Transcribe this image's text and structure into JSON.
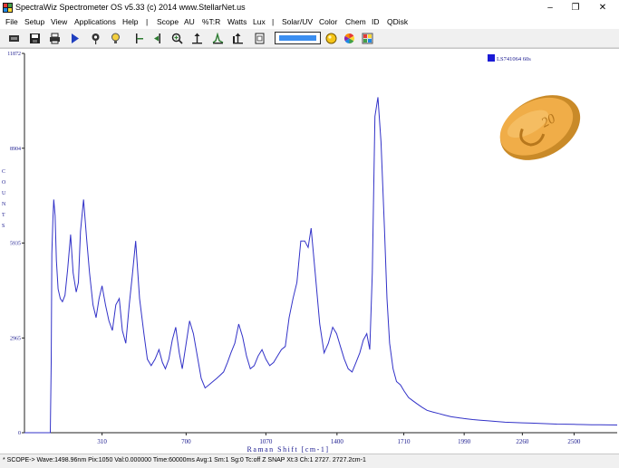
{
  "window": {
    "title": "SpectraWiz  Spectrometer OS v5.33 (c) 2014    www.StellarNet.us",
    "controls": [
      "–",
      "❐",
      "✕"
    ]
  },
  "menu": {
    "items": [
      "File",
      "Setup",
      "View",
      "Applications",
      "Help",
      "|",
      "Scope",
      "AU",
      "%T:R",
      "Watts",
      "Lux",
      "|",
      "Solar/UV",
      "Color",
      "Chem",
      "ID",
      "QDisk"
    ]
  },
  "toolbar": {
    "icons": [
      "toolbar-icon",
      "save-icon",
      "print-icon",
      "play-icon",
      "pin-icon",
      "lightbulb-icon",
      "cursor-left-icon",
      "cursor-right-icon",
      "zoom-icon",
      "autoscale-icon",
      "peak-icon",
      "baseline-icon",
      "page-icon",
      "blue-bar-box",
      "sphere-icon",
      "color-wheel-icon",
      "palette-icon"
    ]
  },
  "chart_data": {
    "type": "line",
    "title": "",
    "xlabel": "Raman Shift [cm-1]",
    "ylabel": "",
    "side_label": "C O U N T S",
    "xlim": [
      -50,
      2700
    ],
    "ylim": [
      0,
      11872
    ],
    "x_ticks": [
      310,
      700,
      1070,
      1400,
      1710,
      1990,
      2260,
      2500
    ],
    "y_ticks": [
      "11872",
      "8904",
      "5935",
      "2965",
      "0"
    ],
    "y_tick_values": [
      11872,
      8904,
      5935,
      2965,
      0
    ],
    "legend": {
      "label": "LS741064 60s",
      "color": "#1b1bd6",
      "position": "top-right"
    },
    "series": [
      {
        "color": "#3232c8",
        "x": [
          -50,
          70,
          74,
          77,
          82,
          86,
          92,
          98,
          106,
          116,
          126,
          138,
          150,
          164,
          176,
          190,
          200,
          210,
          224,
          238,
          252,
          268,
          282,
          296,
          310,
          326,
          342,
          358,
          374,
          390,
          404,
          420,
          436,
          450,
          466,
          484,
          504,
          520,
          538,
          556,
          574,
          590,
          604,
          620,
          636,
          652,
          668,
          682,
          698,
          716,
          734,
          752,
          770,
          788,
          806,
          824,
          842,
          858,
          874,
          892,
          908,
          926,
          944,
          962,
          980,
          998,
          1016,
          1034,
          1052,
          1070,
          1088,
          1106,
          1124,
          1142,
          1160,
          1178,
          1196,
          1214,
          1232,
          1250,
          1266,
          1280,
          1300,
          1320,
          1340,
          1360,
          1380,
          1398,
          1416,
          1434,
          1452,
          1470,
          1488,
          1506,
          1522,
          1538,
          1552,
          1564,
          1576,
          1590,
          1604,
          1620,
          1632,
          1644,
          1660,
          1676,
          1694,
          1712,
          1732,
          1752,
          1772,
          1794,
          1818,
          1844,
          1872,
          1900,
          1930,
          1960,
          1994,
          2030,
          2066,
          2102,
          2140,
          2180,
          2220,
          2260,
          2300,
          2340,
          2380,
          2420,
          2460,
          2500,
          2540,
          2580,
          2620,
          2660,
          2700
        ],
        "y": [
          0,
          0,
          2200,
          5600,
          6700,
          7300,
          6800,
          5400,
          4500,
          4200,
          4100,
          4300,
          5100,
          6200,
          5000,
          4400,
          4700,
          6300,
          7300,
          6100,
          5000,
          4000,
          3600,
          4200,
          4600,
          4000,
          3500,
          3200,
          4000,
          4200,
          3200,
          2800,
          4000,
          4900,
          6000,
          4200,
          3100,
          2300,
          2100,
          2300,
          2600,
          2200,
          2000,
          2300,
          2900,
          3300,
          2500,
          2000,
          2700,
          3500,
          3100,
          2400,
          1700,
          1400,
          1500,
          1600,
          1700,
          1800,
          1900,
          2200,
          2500,
          2800,
          3400,
          3000,
          2400,
          2000,
          2100,
          2400,
          2600,
          2300,
          2100,
          2200,
          2400,
          2600,
          2700,
          3600,
          4200,
          4700,
          6000,
          6000,
          5800,
          6400,
          4900,
          3400,
          2500,
          2800,
          3300,
          3100,
          2700,
          2300,
          2000,
          1900,
          2200,
          2500,
          2900,
          3100,
          2600,
          5000,
          9900,
          10500,
          9100,
          6400,
          4200,
          2800,
          2000,
          1600,
          1500,
          1300,
          1100,
          1000,
          900,
          800,
          700,
          650,
          600,
          550,
          500,
          470,
          440,
          410,
          390,
          370,
          350,
          330,
          320,
          310,
          300,
          290,
          280,
          270,
          265,
          260,
          255,
          250,
          250,
          245,
          240
        ]
      }
    ],
    "grid": false
  },
  "status": {
    "text": "* SCOPE->  Wave:1498.96nm  Pix:1050  Val:0.000000  Time:60000ms  Avg:1  Sm:1  Sg:0  Tc:off  Z  SNAP  Xt:3  Ch:1    2727.  2727.2cm-1"
  }
}
